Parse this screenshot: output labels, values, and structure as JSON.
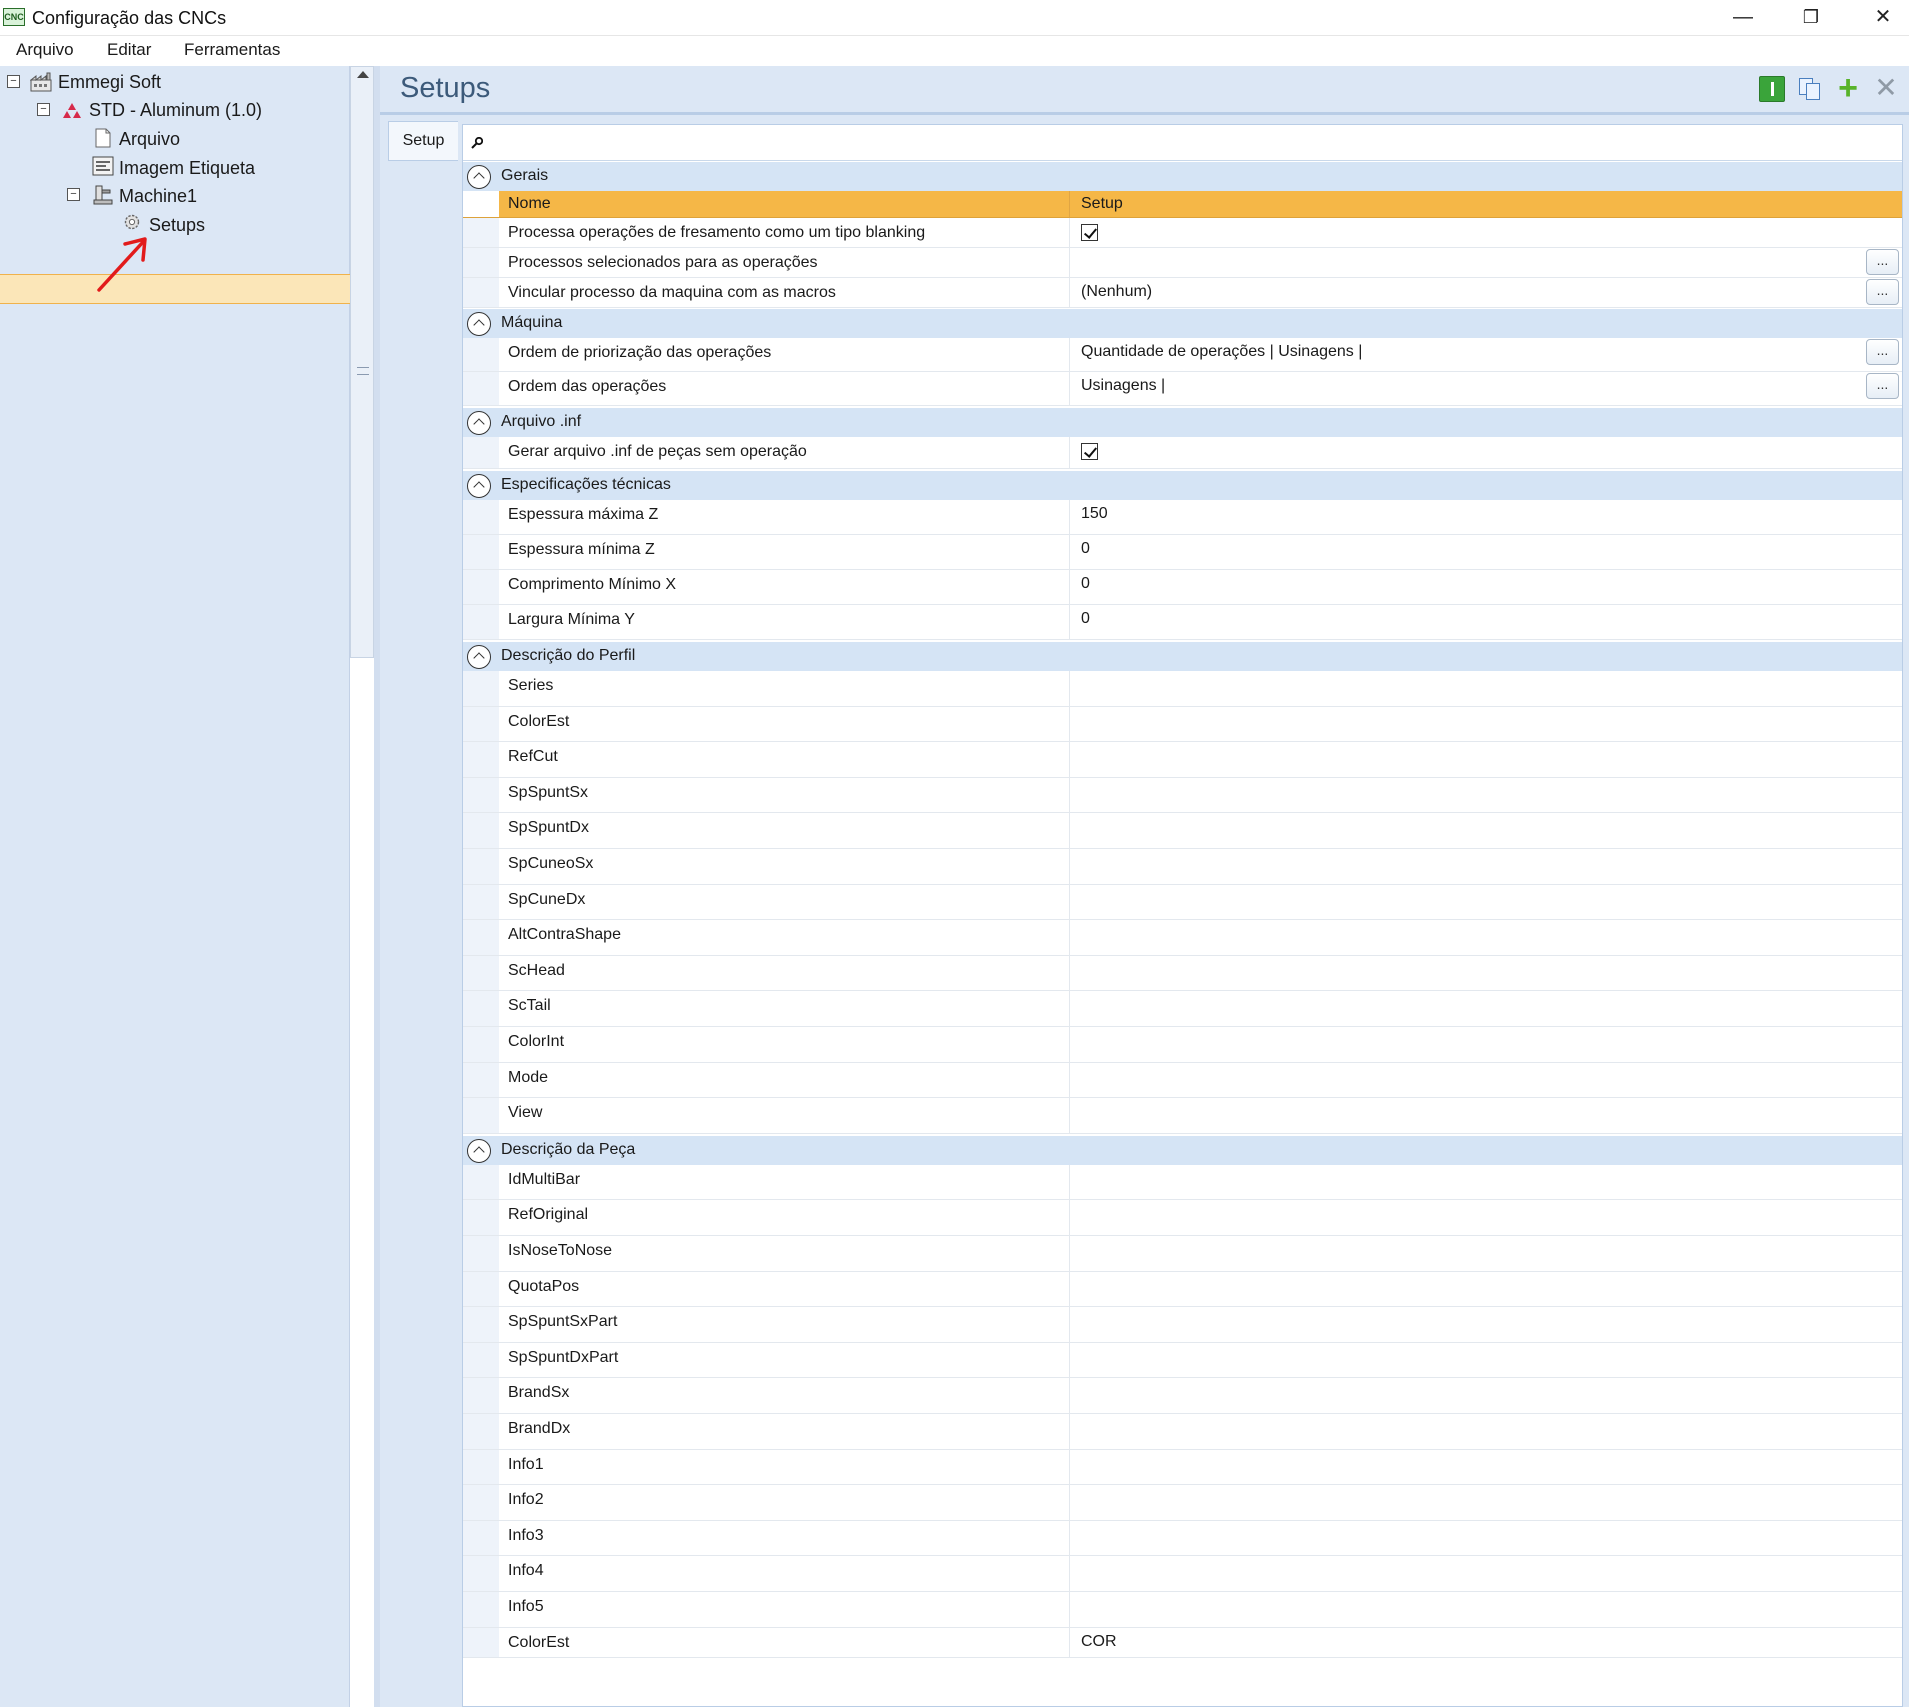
{
  "window": {
    "title": "Configuração das CNCs",
    "icon_text": "CNC",
    "minimize": "—",
    "restore": "❐",
    "close": "✕"
  },
  "menu": [
    "Arquivo",
    "Editar",
    "Ferramentas"
  ],
  "tree": {
    "root": "Emmegi Soft",
    "std": "STD - Aluminum (1.0)",
    "arquivo": "Arquivo",
    "imagem": "Imagem Etiqueta",
    "machine": "Machine1",
    "setups": "Setups",
    "toggle_symbol": "−"
  },
  "panel": {
    "title": "Setups",
    "tab": "Setup",
    "plus_symbol": "+",
    "close_symbol": "✕"
  },
  "grid": {
    "header": {
      "name": "Nome",
      "value": "Setup"
    },
    "ellipsis": "...",
    "categories": {
      "gerais": "Gerais",
      "maquina": "Máquina",
      "arquivo_inf": "Arquivo .inf",
      "especificacoes": "Especificações técnicas",
      "perfil": "Descrição do Perfil",
      "peca": "Descrição da Peça"
    },
    "gerais": [
      {
        "name": "Processa operações de fresamento como um tipo blanking",
        "value": "",
        "checked": true
      },
      {
        "name": "Processos selecionados para as operações",
        "value": ""
      },
      {
        "name": "Vincular processo da maquina com as macros",
        "value": "(Nenhum)"
      }
    ],
    "maquina": [
      {
        "name": "Ordem de priorização das operações",
        "value": "Quantidade de operações | Usinagens |"
      },
      {
        "name": "Ordem das operações",
        "value": "Usinagens |"
      }
    ],
    "arquivo_inf": [
      {
        "name": "Gerar arquivo .inf de peças sem operação",
        "value": "",
        "checked": true
      }
    ],
    "especificacoes": [
      {
        "name": "Espessura máxima Z",
        "value": "150"
      },
      {
        "name": "Espessura mínima Z",
        "value": "0"
      },
      {
        "name": "Comprimento Mínimo X",
        "value": "0"
      },
      {
        "name": "Largura Mínima Y",
        "value": "0"
      }
    ],
    "perfil": [
      "Series",
      "ColorEst",
      "RefCut",
      "SpSpuntSx",
      "SpSpuntDx",
      "SpCuneoSx",
      "SpCuneDx",
      "AltContraShape",
      "ScHead",
      "ScTail",
      "ColorInt",
      "Mode",
      "View"
    ],
    "peca": [
      "IdMultiBar",
      "RefOriginal",
      "IsNoseToNose",
      "QuotaPos",
      "SpSpuntSxPart",
      "SpSpuntDxPart",
      "BrandSx",
      "BrandDx",
      "Info1",
      "Info2",
      "Info3",
      "Info4",
      "Info5"
    ],
    "last_row": {
      "name": "ColorEst",
      "value": "COR"
    }
  },
  "colors": {
    "panel_bg": "#dce7f5",
    "header_orange": "#f5b747",
    "category_bg": "#d5e4f5",
    "selection": "#fbe6b8",
    "title_blue": "#3c5a7a"
  }
}
